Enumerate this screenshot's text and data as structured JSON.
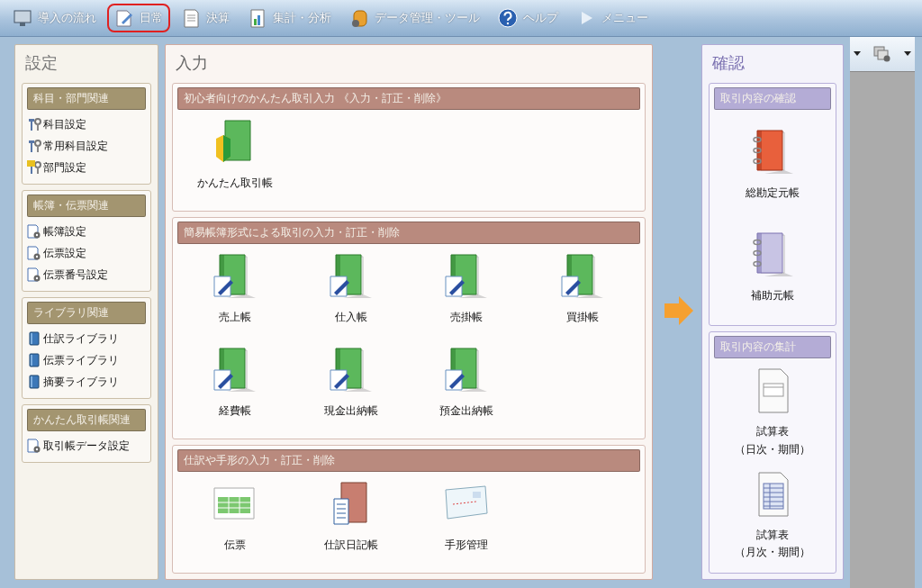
{
  "toolbar": {
    "items": [
      {
        "label": "導入の流れ",
        "kind": "monitor",
        "selected": false
      },
      {
        "label": "日常",
        "kind": "pen",
        "selected": true
      },
      {
        "label": "決算",
        "kind": "document",
        "selected": false
      },
      {
        "label": "集計・分析",
        "kind": "chart",
        "selected": false
      },
      {
        "label": "データ管理・ツール",
        "kind": "database",
        "selected": false
      },
      {
        "label": "ヘルプ",
        "kind": "help",
        "selected": false
      },
      {
        "label": "メニュー",
        "kind": "play",
        "selected": false
      }
    ]
  },
  "settings": {
    "title": "設定",
    "groups": [
      {
        "title": "科目・部門関連",
        "items": [
          {
            "label": "科目設定",
            "kind": "tool"
          },
          {
            "label": "常用科目設定",
            "kind": "tool"
          },
          {
            "label": "部門設定",
            "kind": "startool"
          }
        ]
      },
      {
        "title": "帳簿・伝票関連",
        "items": [
          {
            "label": "帳簿設定",
            "kind": "config"
          },
          {
            "label": "伝票設定",
            "kind": "config"
          },
          {
            "label": "伝票番号設定",
            "kind": "config"
          }
        ]
      },
      {
        "title": "ライブラリ関連",
        "items": [
          {
            "label": "仕訳ライブラリ",
            "kind": "library"
          },
          {
            "label": "伝票ライブラリ",
            "kind": "library"
          },
          {
            "label": "摘要ライブラリ",
            "kind": "library"
          }
        ]
      },
      {
        "title": "かんたん取引帳関連",
        "items": [
          {
            "label": "取引帳データ設定",
            "kind": "config"
          }
        ]
      }
    ]
  },
  "input": {
    "title": "入力",
    "sections": [
      {
        "title": "初心者向けのかんたん取引入力 《入力・訂正・削除》",
        "items": [
          {
            "label": "かんたん取引帳",
            "kind": "beginner"
          }
        ]
      },
      {
        "title": "簡易帳簿形式による取引の入力・訂正・削除",
        "items": [
          {
            "label": "売上帳",
            "kind": "ledger"
          },
          {
            "label": "仕入帳",
            "kind": "ledger"
          },
          {
            "label": "売掛帳",
            "kind": "ledger"
          },
          {
            "label": "買掛帳",
            "kind": "ledger"
          },
          {
            "label": "経費帳",
            "kind": "ledger"
          },
          {
            "label": "現金出納帳",
            "kind": "ledger"
          },
          {
            "label": "預金出納帳",
            "kind": "ledger"
          }
        ]
      },
      {
        "title": "仕訳や手形の入力・訂正・削除",
        "items": [
          {
            "label": "伝票",
            "kind": "slip"
          },
          {
            "label": "仕訳日記帳",
            "kind": "journal"
          },
          {
            "label": "手形管理",
            "kind": "note"
          }
        ]
      }
    ]
  },
  "confirm": {
    "title": "確認",
    "sections": [
      {
        "title": "取引内容の確認",
        "items": [
          {
            "label": "総勘定元帳",
            "kind": "redbook"
          },
          {
            "label": "補助元帳",
            "kind": "purplebook"
          }
        ]
      },
      {
        "title": "取引内容の集計",
        "items": [
          {
            "label": "試算表",
            "sublabel": "（日次・期間）",
            "kind": "sheet"
          },
          {
            "label": "試算表",
            "sublabel": "（月次・期間）",
            "kind": "table"
          }
        ]
      }
    ]
  }
}
